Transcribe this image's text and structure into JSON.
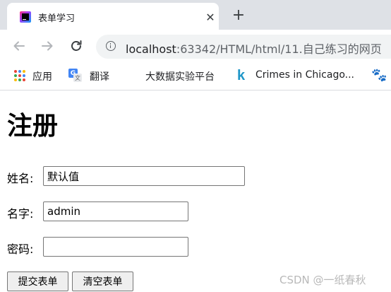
{
  "browser": {
    "tab_title": "表单学习",
    "url_host": "localhost",
    "url_rest": ":63342/HTML/html/11.自己练习的网页"
  },
  "bookmarks": [
    {
      "label": "应用",
      "icon": "apps-grid-icon"
    },
    {
      "label": "翻译",
      "icon": "google-translate-icon"
    },
    {
      "label": "大数据实验平台",
      "icon": ""
    },
    {
      "label": "Crimes in Chicago...",
      "icon": "kaggle-icon"
    },
    {
      "label": "",
      "icon": "baidu-paw-icon"
    }
  ],
  "page": {
    "heading": "注册",
    "form": {
      "name_label": "姓名:",
      "name_value": "默认值",
      "username_label": "名字:",
      "username_value": "admin",
      "password_label": "密码:",
      "password_value": "",
      "submit_label": "提交表单",
      "reset_label": "清空表单"
    }
  },
  "watermark": "CSDN @一纸春秋",
  "colors": {
    "tabstrip_bg": "#dee1e6",
    "omnibox_bg": "#f1f3f4",
    "button_bg": "#efefef",
    "kaggle_blue": "#1e96c8",
    "baidu_blue": "#2932e1"
  }
}
